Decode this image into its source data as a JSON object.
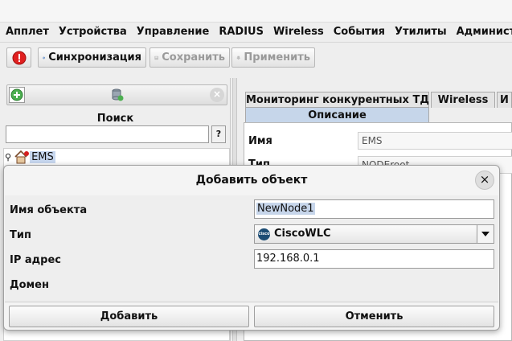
{
  "menu": [
    "Апплет",
    "Устройства",
    "Управление",
    "RADIUS",
    "Wireless",
    "События",
    "Утилиты",
    "Администрир"
  ],
  "toolbar": {
    "sync_label": "Синхронизация",
    "save_label": "Сохранить",
    "apply_label": "Применить"
  },
  "left": {
    "search_label": "Поиск",
    "search_value": "",
    "help_label": "?",
    "tree_root_label": "EMS"
  },
  "right": {
    "tabs": [
      "Мониторинг конкурентных ТД",
      "Wireless",
      "И"
    ],
    "active_tab": "Описание",
    "props": [
      {
        "label": "Имя",
        "value": "EMS"
      },
      {
        "label": "Тип",
        "value": "NODEroot"
      }
    ]
  },
  "dialog": {
    "title": "Добавить объект",
    "close_icon": "×",
    "fields": [
      {
        "label": "Имя объекта",
        "value": "NewNode1"
      },
      {
        "label": "Тип",
        "value": "CiscoWLC"
      },
      {
        "label": "IP адрес",
        "value": "192.168.0.1"
      },
      {
        "label": "Домен",
        "value": ""
      }
    ],
    "add_label": "Добавить",
    "cancel_label": "Отменить"
  },
  "colors": {
    "selection": "#c6d5ea",
    "alert_red": "#e02020",
    "cisco_blue": "#1b4b73"
  }
}
